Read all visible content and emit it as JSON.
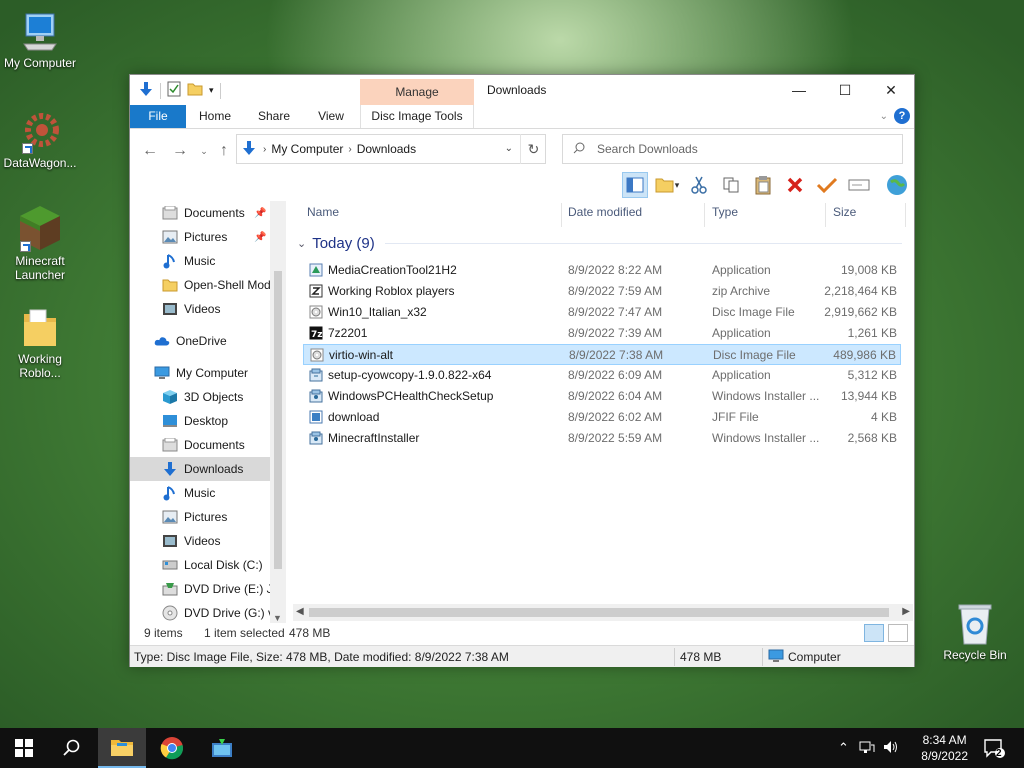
{
  "desktop": {
    "icons": [
      {
        "label": "My Computer",
        "icon": "computer-icon"
      },
      {
        "label": "DataWagon...",
        "icon": "gear-shortcut-icon"
      },
      {
        "label": "Minecraft Launcher",
        "icon": "minecraft-icon"
      },
      {
        "label": "Working Roblo...",
        "icon": "folder-icon"
      },
      {
        "label": "Recycle Bin",
        "icon": "recycle-bin-icon"
      }
    ]
  },
  "window": {
    "title": "Downloads",
    "manage_label": "Manage",
    "tabs": {
      "file": "File",
      "home": "Home",
      "share": "Share",
      "view": "View",
      "disc": "Disc Image Tools"
    },
    "address": {
      "crumbs": [
        "My Computer",
        "Downloads"
      ]
    },
    "search_placeholder": "Search Downloads",
    "nav": [
      {
        "label": "Documents",
        "icon": "documents-icon",
        "pinned": true
      },
      {
        "label": "Pictures",
        "icon": "pictures-icon",
        "pinned": true
      },
      {
        "label": "Music",
        "icon": "music-icon"
      },
      {
        "label": "Open-Shell Mod",
        "icon": "folder-icon"
      },
      {
        "label": "Videos",
        "icon": "videos-icon"
      },
      {
        "label": "OneDrive",
        "icon": "onedrive-icon"
      },
      {
        "label": "My Computer",
        "icon": "computer-icon"
      },
      {
        "label": "3D Objects",
        "icon": "3d-objects-icon"
      },
      {
        "label": "Desktop",
        "icon": "desktop-icon"
      },
      {
        "label": "Documents",
        "icon": "documents-icon"
      },
      {
        "label": "Downloads",
        "icon": "downloads-icon",
        "selected": true
      },
      {
        "label": "Music",
        "icon": "music-icon"
      },
      {
        "label": "Pictures",
        "icon": "pictures-icon"
      },
      {
        "label": "Videos",
        "icon": "videos-icon"
      },
      {
        "label": "Local Disk (C:)",
        "icon": "drive-icon"
      },
      {
        "label": "DVD Drive (E:) J_",
        "icon": "dvd-drive-icon"
      },
      {
        "label": "DVD Drive (G:) vi",
        "icon": "dvd-drive-icon"
      }
    ],
    "columns": {
      "name": "Name",
      "date": "Date modified",
      "type": "Type",
      "size": "Size"
    },
    "group": "Today (9)",
    "files": [
      {
        "name": "MediaCreationTool21H2",
        "date": "8/9/2022 8:22 AM",
        "type": "Application",
        "size": "19,008 KB",
        "icon": "app-icon"
      },
      {
        "name": "Working Roblox players",
        "date": "8/9/2022 7:59 AM",
        "type": "zip Archive",
        "size": "2,218,464 KB",
        "icon": "zip-icon"
      },
      {
        "name": "Win10_Italian_x32",
        "date": "8/9/2022 7:47 AM",
        "type": "Disc Image File",
        "size": "2,919,662 KB",
        "icon": "disc-image-icon"
      },
      {
        "name": "7z2201",
        "date": "8/9/2022 7:39 AM",
        "type": "Application",
        "size": "1,261 KB",
        "icon": "7zip-icon"
      },
      {
        "name": "virtio-win-alt",
        "date": "8/9/2022 7:38 AM",
        "type": "Disc Image File",
        "size": "489,986 KB",
        "icon": "disc-image-icon",
        "selected": true
      },
      {
        "name": "setup-cyowcopy-1.9.0.822-x64",
        "date": "8/9/2022 6:09 AM",
        "type": "Application",
        "size": "5,312 KB",
        "icon": "installer-icon"
      },
      {
        "name": "WindowsPCHealthCheckSetup",
        "date": "8/9/2022 6:04 AM",
        "type": "Windows Installer ...",
        "size": "13,944 KB",
        "icon": "msi-icon"
      },
      {
        "name": "download",
        "date": "8/9/2022 6:02 AM",
        "type": "JFIF File",
        "size": "4 KB",
        "icon": "image-file-icon"
      },
      {
        "name": "MinecraftInstaller",
        "date": "8/9/2022 5:59 AM",
        "type": "Windows Installer ...",
        "size": "2,568 KB",
        "icon": "msi-icon"
      }
    ],
    "status": {
      "count": "9 items",
      "selected": "1 item selected",
      "size": "478 MB"
    },
    "details": {
      "text": "Type: Disc Image File, Size: 478 MB, Date modified: 8/9/2022 7:38 AM",
      "size": "478 MB",
      "location": "Computer"
    }
  },
  "taskbar": {
    "time": "8:34 AM",
    "date": "8/9/2022",
    "notifications": "2"
  }
}
